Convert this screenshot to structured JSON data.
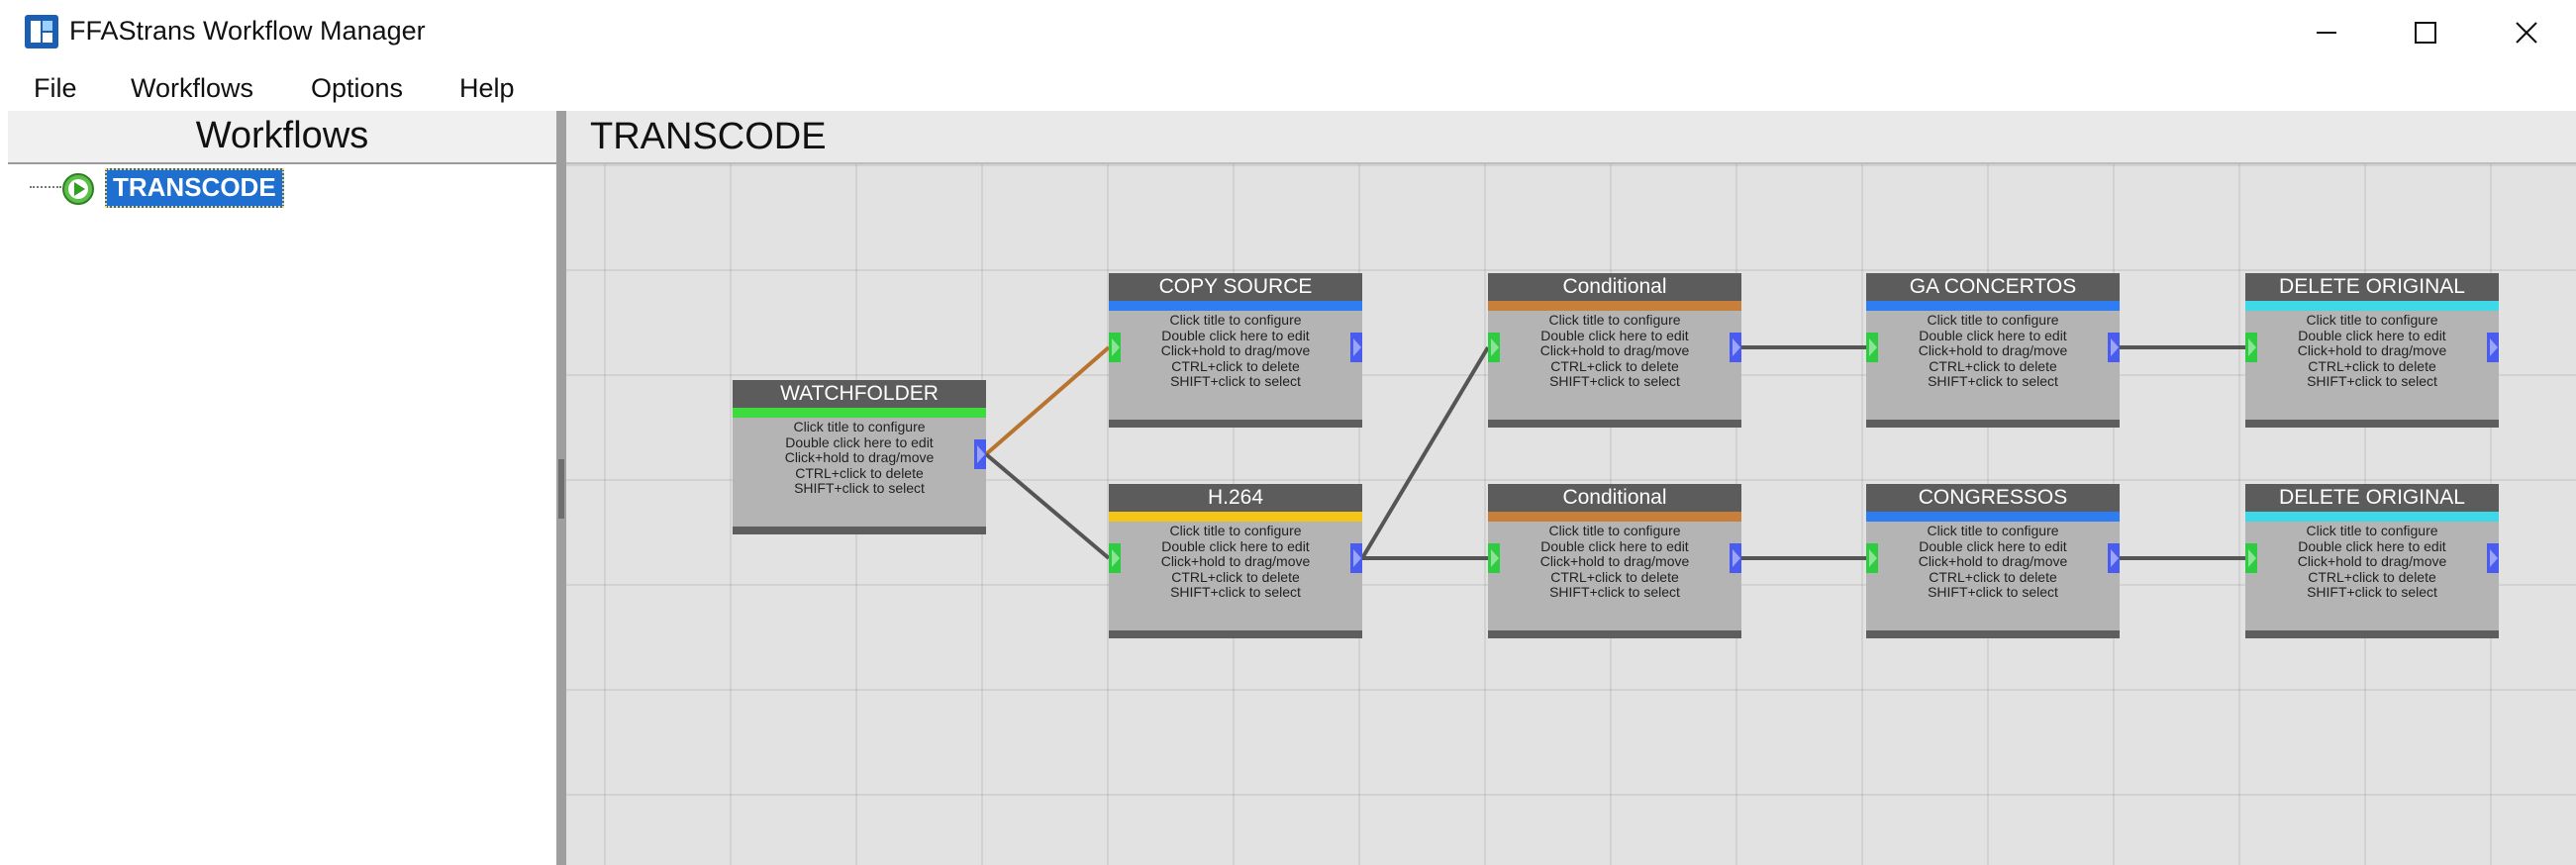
{
  "window": {
    "title": "FFAStrans Workflow Manager",
    "icon": "app-logo-icon",
    "controls": [
      "minimize-icon",
      "maximize-icon",
      "close-icon"
    ]
  },
  "menu": {
    "file": "File",
    "workflows": "Workflows",
    "options": "Options",
    "help": "Help"
  },
  "left_panel": {
    "title": "Workflows",
    "tree": [
      {
        "label": "TRANSCODE",
        "icon": "play-circle-icon",
        "selected": true
      }
    ]
  },
  "canvas": {
    "title": "TRANSCODE",
    "node_hints": [
      "Click title to configure",
      "Double click here to edit",
      "Click+hold to drag/move",
      "CTRL+click to delete",
      "SHIFT+click to select"
    ],
    "nodes": [
      {
        "title": "WATCHFOLDER",
        "color": "#3ddb3d"
      },
      {
        "title": "COPY SOURCE",
        "color": "#2f7df2"
      },
      {
        "title": "H.264",
        "color": "#f5c518"
      },
      {
        "title": "Conditional",
        "color": "#c87f3a"
      },
      {
        "title": "Conditional",
        "color": "#c87f3a"
      },
      {
        "title": "GA CONCERTOS",
        "color": "#2f7df2"
      },
      {
        "title": "CONGRESSOS",
        "color": "#2f7df2"
      },
      {
        "title": "DELETE ORIGINAL",
        "color": "#3ed8e8"
      },
      {
        "title": "DELETE ORIGINAL",
        "color": "#3ed8e8"
      }
    ],
    "colors": {
      "port_in": "#2ecc40",
      "port_out": "#4a5cf0",
      "wire_orange": "#b8742e",
      "wire_dark": "#555555",
      "selection": "#1e6fd0"
    }
  }
}
